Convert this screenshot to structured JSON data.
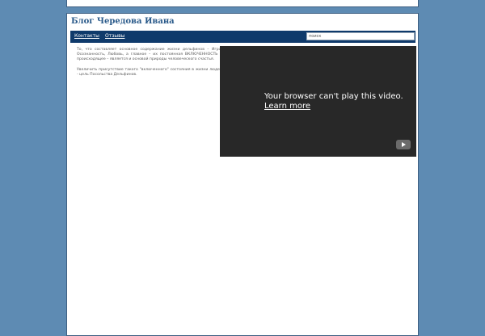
{
  "header": {
    "title": "Блог Чередова Ивана"
  },
  "nav": {
    "items": [
      {
        "label": "Контакты"
      },
      {
        "label": "Отзывы"
      }
    ],
    "search_placeholder": "поиск"
  },
  "article": {
    "paragraphs": [
      "То, что составляет основное содержание жизни дельфинов – Игра, Осознанность, Любовь, а главное – их постоянная ВКЛЮЧЕННОСТЬ в происходящее – является и основой природы человеческого счастья.",
      "Увеличить присутствие такого \"включенного\" состояния в жизни людей - цель Посольства Дельфинов."
    ]
  },
  "video": {
    "message": "Your browser can't play this video.",
    "link_label": "Learn more",
    "play_icon": "youtube-play-icon"
  }
}
